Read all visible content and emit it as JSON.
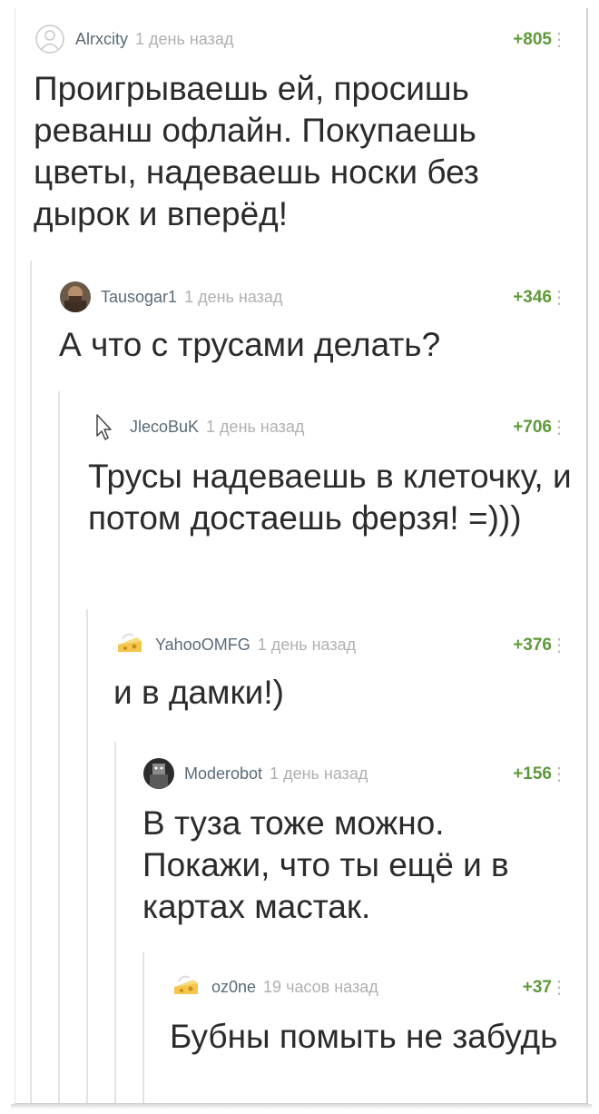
{
  "comments": [
    {
      "author": "Alrxcity",
      "time": "1 день назад",
      "rating": "+805",
      "text": "Проигрываешь ей, просишь реванш офлайн. Покупаешь цветы, надеваешь носки без дырок и вперёд!",
      "avatar_icon": "default-avatar-icon"
    },
    {
      "author": "Tausogar1",
      "time": "1 день назад",
      "rating": "+346",
      "text": "А что с трусами делать?",
      "avatar_icon": "user-photo-avatar"
    },
    {
      "author": "JlecoBuK",
      "time": "1 день назад",
      "rating": "+706",
      "text": "Трусы надеваешь в клеточку, и потом достаешь ферзя! =)))",
      "avatar_icon": "cursor-arrow-icon"
    },
    {
      "author": "YahooOMFG",
      "time": "1 день назад",
      "rating": "+376",
      "text": "и в дамки!)",
      "avatar_icon": "cheese-avatar-icon"
    },
    {
      "author": "Moderobot",
      "time": "1 день назад",
      "rating": "+156",
      "text": "В туза тоже можно. Покажи, что ты ещё и в картах мастак.",
      "avatar_icon": "robot-photo-avatar"
    },
    {
      "author": "oz0ne",
      "time": "19 часов назад",
      "rating": "+37",
      "text": "Бубны помыть не забудь",
      "avatar_icon": "cheese-avatar-icon"
    }
  ],
  "more_glyph": "⋮",
  "colors": {
    "rating": "#5e9a3a",
    "author": "#5a6a78",
    "time": "#b0b0b0",
    "text": "#2b2b2b",
    "thread_line": "#e3e3e3"
  }
}
